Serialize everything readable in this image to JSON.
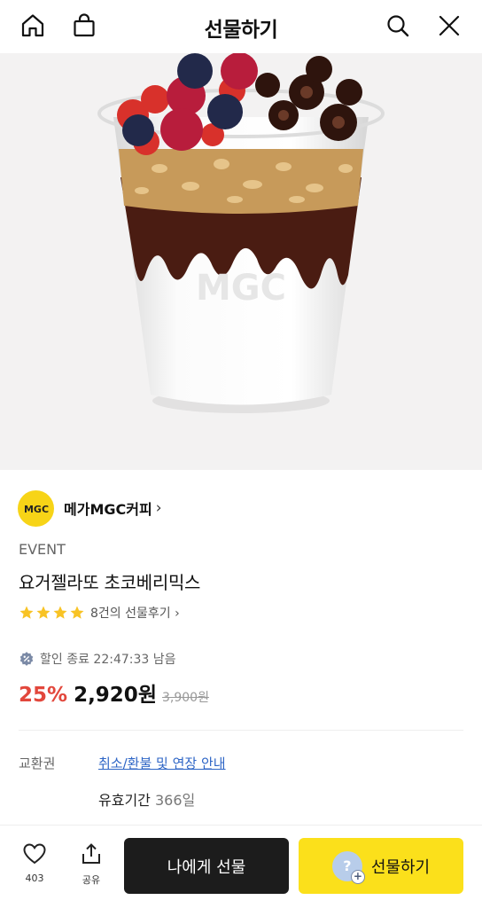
{
  "header": {
    "title": "선물하기",
    "icons": [
      "home-icon",
      "shopping-bag-icon",
      "search-icon",
      "close-icon"
    ]
  },
  "product": {
    "brand": "메가MGC커피",
    "brand_logo_text": "MGC",
    "event_tag": "EVENT",
    "name": "요거젤라또 초코베리믹스",
    "rating_stars": 4,
    "review_text": "8건의 선물후기",
    "discount_text": "할인 종료 22:47:33 남음",
    "discount_percent": "25%",
    "price": "2,920원",
    "original_price": "3,900원",
    "cup_logo_text": "MGC"
  },
  "info": {
    "exchange_label": "교환권",
    "policy_link": "취소/환불 및 연장 안내",
    "validity_label": "유효기간",
    "validity_value": "366일"
  },
  "bottom": {
    "like_count": "403",
    "share_label": "공유",
    "self_button": "나에게 선물",
    "gift_button": "선물하기"
  },
  "colors": {
    "accent_red": "#e2473c",
    "gift_yellow": "#fbe01b",
    "link_blue": "#2f66c6",
    "brand_yellow": "#f7d417"
  }
}
